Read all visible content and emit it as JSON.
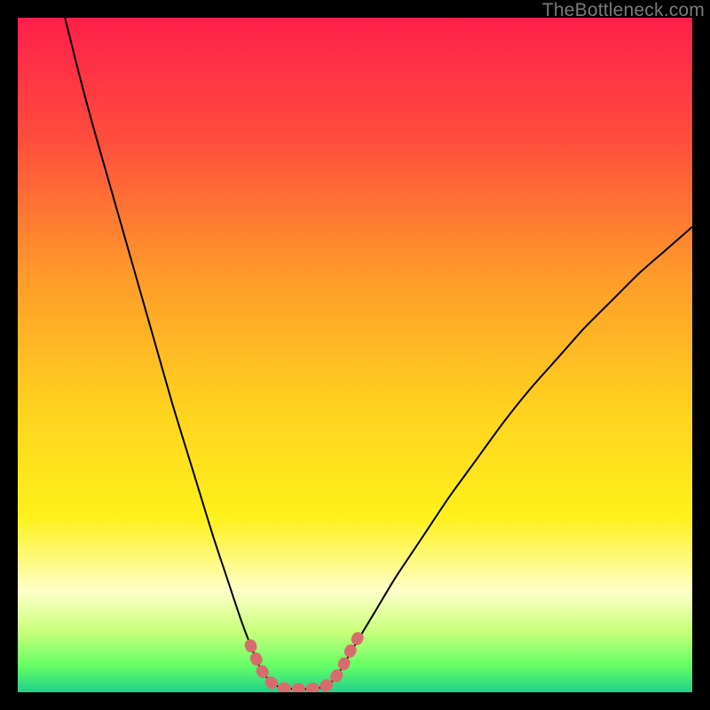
{
  "watermark": "TheBottleneck.com",
  "chart_data": {
    "type": "line",
    "title": "",
    "xlabel": "",
    "ylabel": "",
    "xlim": [
      0,
      100
    ],
    "ylim": [
      0,
      100
    ],
    "background_gradient": {
      "stops": [
        {
          "offset": 0.0,
          "color": "#ff1f4a"
        },
        {
          "offset": 0.18,
          "color": "#ff4d3d"
        },
        {
          "offset": 0.38,
          "color": "#ff9a2a"
        },
        {
          "offset": 0.58,
          "color": "#ffd21f"
        },
        {
          "offset": 0.74,
          "color": "#fff11a"
        },
        {
          "offset": 0.85,
          "color": "#ffffc8"
        },
        {
          "offset": 0.91,
          "color": "#c8ff7a"
        },
        {
          "offset": 0.96,
          "color": "#66ff66"
        },
        {
          "offset": 1.0,
          "color": "#1fd18a"
        }
      ]
    },
    "series": [
      {
        "name": "left-curve",
        "color": "#000000",
        "width": 2,
        "points": [
          {
            "x": 7.0,
            "y": 100.0
          },
          {
            "x": 9.0,
            "y": 92.0
          },
          {
            "x": 11.0,
            "y": 84.5
          },
          {
            "x": 13.0,
            "y": 77.5
          },
          {
            "x": 15.0,
            "y": 70.5
          },
          {
            "x": 17.0,
            "y": 63.5
          },
          {
            "x": 19.0,
            "y": 56.5
          },
          {
            "x": 21.0,
            "y": 49.5
          },
          {
            "x": 23.0,
            "y": 42.5
          },
          {
            "x": 25.0,
            "y": 36.0
          },
          {
            "x": 27.0,
            "y": 29.5
          },
          {
            "x": 29.0,
            "y": 23.0
          },
          {
            "x": 31.0,
            "y": 17.0
          },
          {
            "x": 33.0,
            "y": 11.0
          },
          {
            "x": 34.5,
            "y": 7.0
          },
          {
            "x": 36.0,
            "y": 3.5
          },
          {
            "x": 37.5,
            "y": 1.5
          },
          {
            "x": 39.0,
            "y": 0.7
          },
          {
            "x": 41.0,
            "y": 0.5
          },
          {
            "x": 43.0,
            "y": 0.5
          },
          {
            "x": 45.0,
            "y": 0.7
          },
          {
            "x": 46.5,
            "y": 1.5
          },
          {
            "x": 48.0,
            "y": 3.5
          }
        ]
      },
      {
        "name": "right-curve",
        "color": "#000000",
        "width": 2,
        "points": [
          {
            "x": 48.0,
            "y": 3.5
          },
          {
            "x": 50.0,
            "y": 7.0
          },
          {
            "x": 53.0,
            "y": 12.0
          },
          {
            "x": 56.0,
            "y": 17.0
          },
          {
            "x": 60.0,
            "y": 23.0
          },
          {
            "x": 64.0,
            "y": 29.0
          },
          {
            "x": 68.0,
            "y": 34.5
          },
          {
            "x": 72.0,
            "y": 40.0
          },
          {
            "x": 76.0,
            "y": 45.0
          },
          {
            "x": 80.0,
            "y": 49.5
          },
          {
            "x": 84.0,
            "y": 54.0
          },
          {
            "x": 88.0,
            "y": 58.0
          },
          {
            "x": 92.0,
            "y": 62.0
          },
          {
            "x": 96.0,
            "y": 65.5
          },
          {
            "x": 100.0,
            "y": 69.0
          }
        ]
      },
      {
        "name": "bottom-highlight",
        "color": "#d86c6c",
        "width": 13,
        "linecap": "round",
        "points": [
          {
            "x": 34.5,
            "y": 7.0
          },
          {
            "x": 36.0,
            "y": 3.5
          },
          {
            "x": 37.5,
            "y": 1.5
          },
          {
            "x": 39.0,
            "y": 0.7
          },
          {
            "x": 41.0,
            "y": 0.5
          },
          {
            "x": 43.0,
            "y": 0.5
          },
          {
            "x": 45.0,
            "y": 0.7
          },
          {
            "x": 46.5,
            "y": 1.5
          },
          {
            "x": 48.0,
            "y": 3.5
          },
          {
            "x": 49.5,
            "y": 6.5
          },
          {
            "x": 50.5,
            "y": 8.2
          }
        ]
      }
    ]
  }
}
